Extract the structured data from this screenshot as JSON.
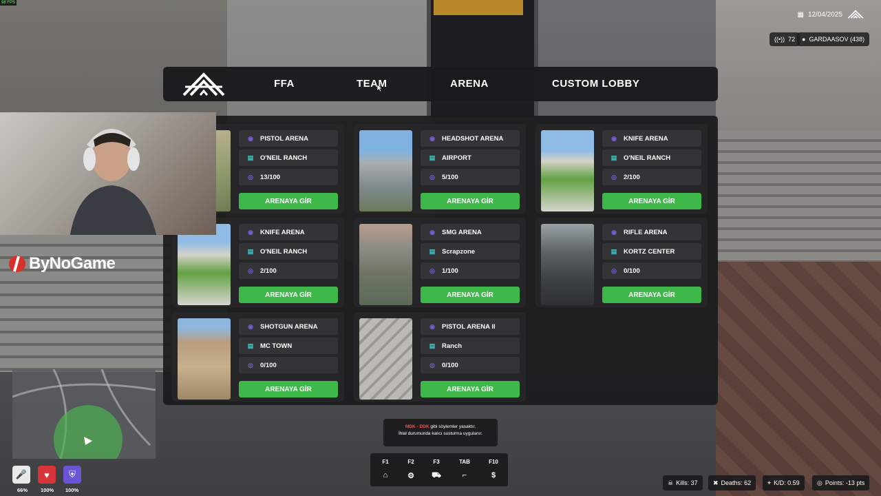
{
  "hud": {
    "fps": "98 FPS",
    "date": "12/04/2025",
    "ping": "72",
    "player": "GARDAASOV (438)"
  },
  "nav": {
    "tabs": [
      "FFA",
      "TEAM",
      "ARENA",
      "CUSTOM LOBBY"
    ]
  },
  "arenas": [
    {
      "name": "PISTOL ARENA",
      "map": "O'NEIL RANCH",
      "players": "13/100",
      "button": "ARENAYA GİR"
    },
    {
      "name": "HEADSHOT ARENA",
      "map": "AIRPORT",
      "players": "5/100",
      "button": "ARENAYA GİR"
    },
    {
      "name": "KNIFE ARENA",
      "map": "O'NEIL RANCH",
      "players": "2/100",
      "button": "ARENAYA GİR"
    },
    {
      "name": "KNIFE ARENA",
      "map": "O'NEIL RANCH",
      "players": "2/100",
      "button": "ARENAYA GİR"
    },
    {
      "name": "SMG ARENA",
      "map": "Scrapzone",
      "players": "1/100",
      "button": "ARENAYA GİR"
    },
    {
      "name": "RIFLE ARENA",
      "map": "KORTZ CENTER",
      "players": "0/100",
      "button": "ARENAYA GİR"
    },
    {
      "name": "SHOTGUN ARENA",
      "map": "MC TOWN",
      "players": "0/100",
      "button": "ARENAYA GİR"
    },
    {
      "name": "PISTOL ARENA II",
      "map": "Ranch",
      "players": "0/100",
      "button": "ARENAYA GİR"
    }
  ],
  "branding": {
    "watermark": "ByNoGame"
  },
  "status": {
    "voice_pct": "66%",
    "health_pct": "100%",
    "armor_pct": "100%"
  },
  "notice": {
    "highlight": "MDK - DDK",
    "line1": "gibi söylemler yasaktır.",
    "line2": "İhlal durumunda kalıcı susturma uygulanır."
  },
  "hotkeys": [
    "F1",
    "F2",
    "F3",
    "TAB",
    "F10"
  ],
  "stats": {
    "kills": "Kills: 37",
    "deaths": "Deaths: 62",
    "kd": "K/D: 0.59",
    "points": "Points: -13 pts"
  },
  "colors": {
    "accent_green": "#3fb84a",
    "panel_bg": "#1c1c1e",
    "icon_purple": "#7b5cd6",
    "icon_teal": "#3ec7c7"
  }
}
